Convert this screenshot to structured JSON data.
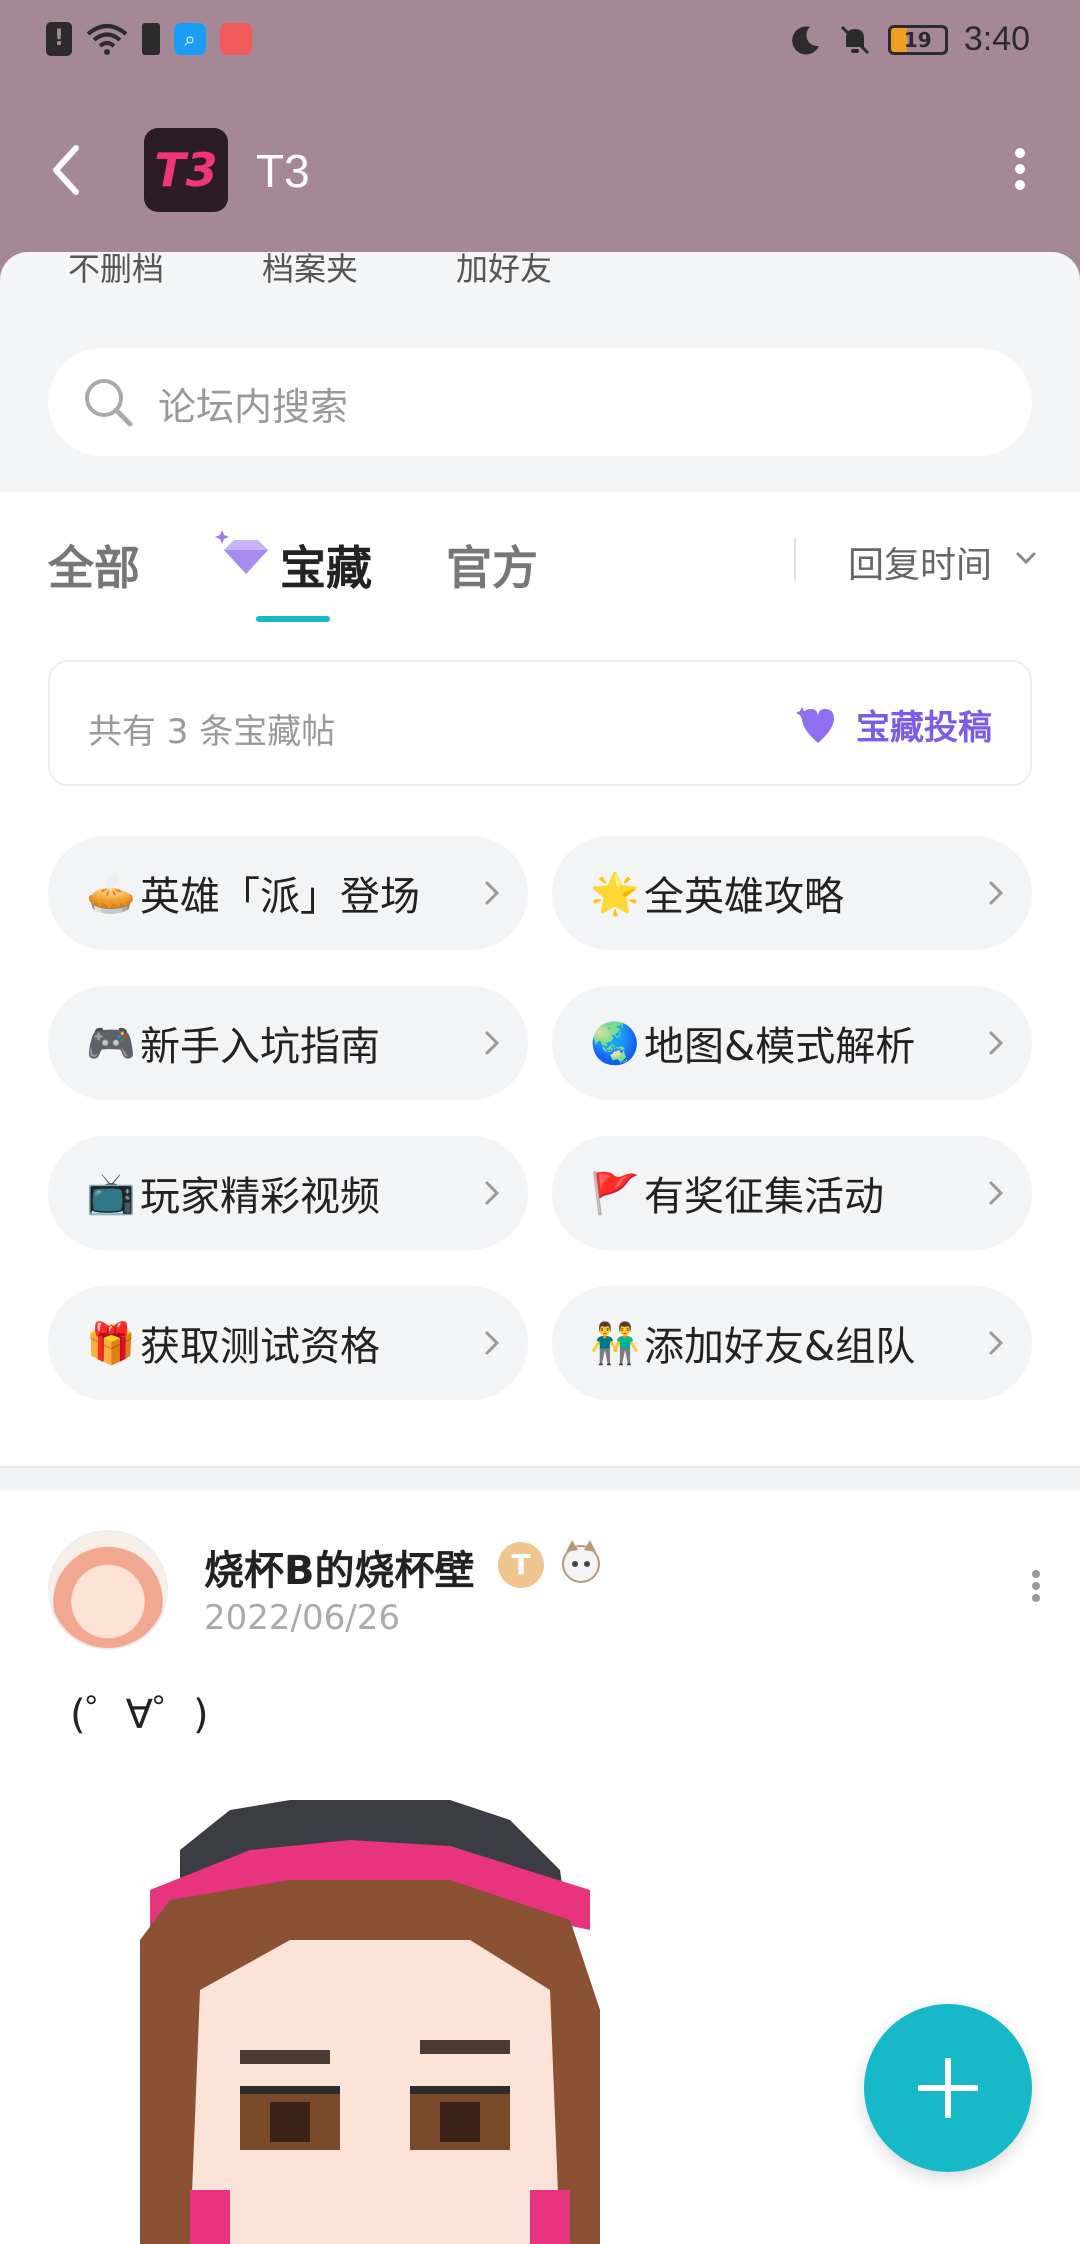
{
  "status_bar": {
    "time": "3:40",
    "battery": "19"
  },
  "header": {
    "logo_text": "T3",
    "title": "T3"
  },
  "quick_links": [
    "不删档",
    "档案夹",
    "加好友"
  ],
  "search": {
    "placeholder": "论坛内搜索"
  },
  "tabs": {
    "all": "全部",
    "treasure": "宝藏",
    "official": "官方",
    "sort_label": "回复时间"
  },
  "treasure_card": {
    "count_text": "共有 3 条宝藏帖",
    "submit_label": "宝藏投稿"
  },
  "chips": [
    {
      "emoji": "🥧",
      "label": " 英雄「派」登场"
    },
    {
      "emoji": "🌟",
      "label": "全英雄攻略"
    },
    {
      "emoji": "🎮",
      "label": "新手入坑指南"
    },
    {
      "emoji": "🌏",
      "label": "地图&模式解析"
    },
    {
      "emoji": "📺",
      "label": "玩家精彩视频"
    },
    {
      "emoji": "🚩",
      "label": "有奖征集活动"
    },
    {
      "emoji": "🎁",
      "label": "获取测试资格"
    },
    {
      "emoji": "👬",
      "label": "添加好友&组队"
    }
  ],
  "post": {
    "username": "烧杯B的烧杯壁",
    "badge": "T",
    "date": "2022/06/26",
    "text": "(゜∀゜)"
  },
  "colors": {
    "header_bg": "#a58896",
    "accent": "#17b8c8",
    "treasure_purple": "#7b5ce8",
    "logo_pink": "#f0357a"
  }
}
